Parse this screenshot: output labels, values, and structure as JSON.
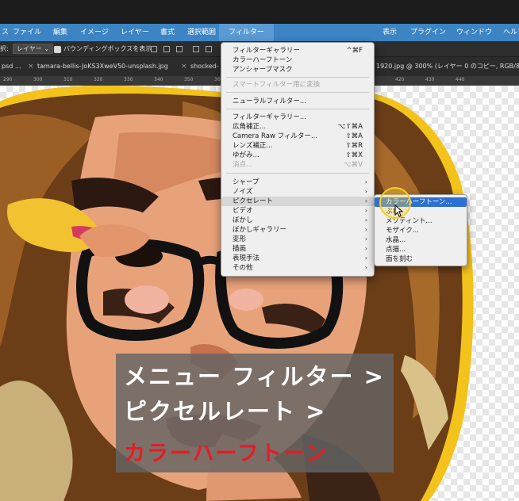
{
  "menubar": {
    "items": [
      "ファイル",
      "編集",
      "イメージ",
      "レイヤー",
      "書式",
      "選択範囲",
      "フィルター",
      "表示",
      "プラグイン",
      "ウィンドウ",
      "ヘルプ"
    ],
    "left_partial": "ス"
  },
  "options_bar": {
    "prefix": "択:",
    "layer_select": "レイヤー",
    "bounding_box_label": "バウンディングボックスを表示"
  },
  "tabs": [
    {
      "title": "psd ..."
    },
    {
      "title": "tamara-bellis-JoKS3XweV50-unsplash.jpg"
    },
    {
      "title": "shocked-"
    }
  ],
  "active_tab_title": "1920.jpg @ 300% (レイヤー 0 のコピー, RGB/8#",
  "ruler_marks": [
    "290",
    "300",
    "310",
    "320",
    "330",
    "340",
    "350",
    "360",
    "370",
    "380",
    "390",
    "400",
    "410",
    "420",
    "430",
    "440"
  ],
  "filter_menu": {
    "groups": [
      [
        {
          "label": "フィルターギャラリー",
          "shortcut": "^⌘F"
        },
        {
          "label": "カラーハーフトーン"
        },
        {
          "label": "アンシャープマスク"
        }
      ],
      [
        {
          "label": "スマートフィルター用に変換",
          "disabled": true
        }
      ],
      [
        {
          "label": "ニューラルフィルター..."
        }
      ],
      [
        {
          "label": "フィルターギャラリー..."
        },
        {
          "label": "広角補正...",
          "shortcut": "⌥⇧⌘A"
        },
        {
          "label": "Camera Raw フィルター...",
          "shortcut": "⇧⌘A"
        },
        {
          "label": "レンズ補正...",
          "shortcut": "⇧⌘R"
        },
        {
          "label": "ゆがみ...",
          "shortcut": "⇧⌘X"
        },
        {
          "label": "消点...",
          "shortcut": "⌥⌘V",
          "disabled": true
        }
      ],
      [
        {
          "label": "シャープ",
          "submenu": true
        },
        {
          "label": "ノイズ",
          "submenu": true
        },
        {
          "label": "ピクセレート",
          "submenu": true,
          "highlighted": true
        },
        {
          "label": "ビデオ",
          "submenu": true
        },
        {
          "label": "ぼかし",
          "submenu": true
        },
        {
          "label": "ぼかしギャラリー",
          "submenu": true
        },
        {
          "label": "変形",
          "submenu": true
        },
        {
          "label": "描画",
          "submenu": true
        },
        {
          "label": "表現手法",
          "submenu": true
        },
        {
          "label": "その他",
          "submenu": true
        }
      ]
    ]
  },
  "pixelate_submenu": {
    "items": [
      {
        "label": "カラーハーフトーン...",
        "selected": true
      },
      {
        "label": "ぶれ"
      },
      {
        "label": "メゾティント..."
      },
      {
        "label": "モザイク..."
      },
      {
        "label": "水晶..."
      },
      {
        "label": "点描..."
      },
      {
        "label": "面を刻む"
      }
    ]
  },
  "caption": {
    "line1": "メニュー フィルター >",
    "line2": "ピクセルレート >",
    "line3": "カラーハーフトーン",
    "line3_color": "#e51c24"
  },
  "colors": {
    "menubar": "#3c84c4",
    "selection": "#2d6fd3",
    "cursor_highlight": "#f2cf2c"
  },
  "icons": [
    "apple-menu-hidden",
    "cursor-pointer-icon",
    "submenu-arrow-icon",
    "tab-close-icon",
    "checkbox-icon",
    "align-icons"
  ]
}
